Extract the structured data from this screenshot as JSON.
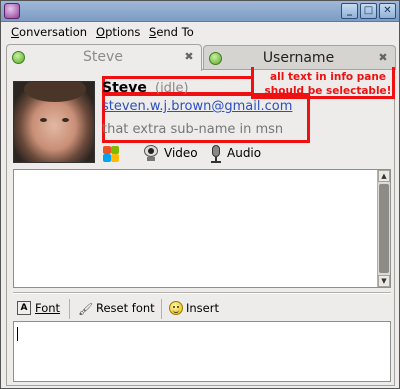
{
  "window": {
    "buttons": {
      "minimize": "_",
      "maximize": "□",
      "close": "✕"
    }
  },
  "menu": {
    "items": [
      {
        "label": "Conversation",
        "mnemonic": "C"
      },
      {
        "label": "Options",
        "mnemonic": "O"
      },
      {
        "label": "Send To",
        "mnemonic": "S"
      }
    ]
  },
  "tabs": [
    {
      "label": "Steve",
      "active": true
    },
    {
      "label": "Username",
      "active": false
    }
  ],
  "contact": {
    "name": "Steve",
    "status": "(idle)",
    "email": "steven.w.j.brown@gmail.com",
    "subname": "that extra sub-name in msn",
    "annotation": "all text in info pane should be selectable!"
  },
  "actions": {
    "video_label": "Video",
    "audio_label": "Audio"
  },
  "toolbar": {
    "font_label": "Font",
    "reset_label": "Reset font",
    "insert_label": "Insert"
  },
  "colors": {
    "annotation_red": "#ee1111",
    "link_blue": "#2c4fbe",
    "status_green": "#5aa82a"
  },
  "icons": {
    "app": "pidgin-icon",
    "status": "available-status-icon",
    "tab_close": "close-icon",
    "msn": "msn-butterfly-icon",
    "video": "webcam-icon",
    "audio": "microphone-icon",
    "font": "font-icon",
    "reset": "brush-icon",
    "insert": "smiley-icon"
  }
}
